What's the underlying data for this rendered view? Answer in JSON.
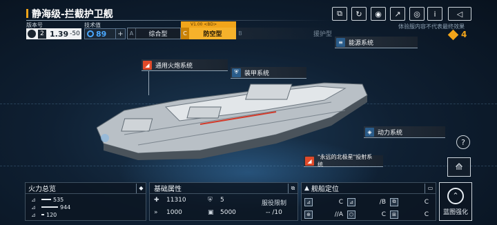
{
  "header": {
    "title": "静海级-拦截护卫舰",
    "version_label": "版本号",
    "version_value": "2",
    "version_rating": "1.39",
    "version_rating_suffix": "-50",
    "tech_label": "技术值",
    "tech_value": "89",
    "disclaimer": "体验服内容不代表最终效果",
    "resource_count": "4"
  },
  "toolbar": {
    "icons": [
      "share-icon",
      "refresh-icon",
      "camera-icon",
      "export-icon",
      "target-icon",
      "info-icon",
      "back-icon"
    ],
    "info_glyph": "i"
  },
  "variants": {
    "tab_a_letter": "A",
    "tab_a_label": "综合型",
    "tab_c_letter": "C",
    "tab_c_label": "防空型",
    "tab_c_sub": "V1.00 <BD>",
    "tab_b_letter": "B",
    "tab_b_label": "援护型"
  },
  "systems": {
    "energy": "能源系统",
    "cannon": "通用火炮系统",
    "armor": "装甲系统",
    "power": "动力系统",
    "launcher": "\"永远的北极星\"投射系统"
  },
  "firepower": {
    "title": "火力总览",
    "rows": [
      {
        "value": "535"
      },
      {
        "value": "944"
      },
      {
        "value": "120"
      }
    ]
  },
  "basic": {
    "title": "基础属性",
    "hp": "11310",
    "armor": "5",
    "speed": "1000",
    "cargo": "5000",
    "service_label": "服役限制",
    "service_value": "-- /10"
  },
  "position": {
    "title": "舰船定位",
    "cells": [
      {
        "value": "C"
      },
      {
        "value": "/B"
      },
      {
        "value": "C"
      },
      {
        "value": "//A"
      },
      {
        "value": "C"
      },
      {
        "value": "C"
      }
    ]
  },
  "enhance": {
    "label": "蓝图强化"
  },
  "colors": {
    "accent": "#f2a51a",
    "tech_blue": "#4aa8ff",
    "cannon_red": "#e04a2a",
    "panel_bg": "#0c1622"
  }
}
